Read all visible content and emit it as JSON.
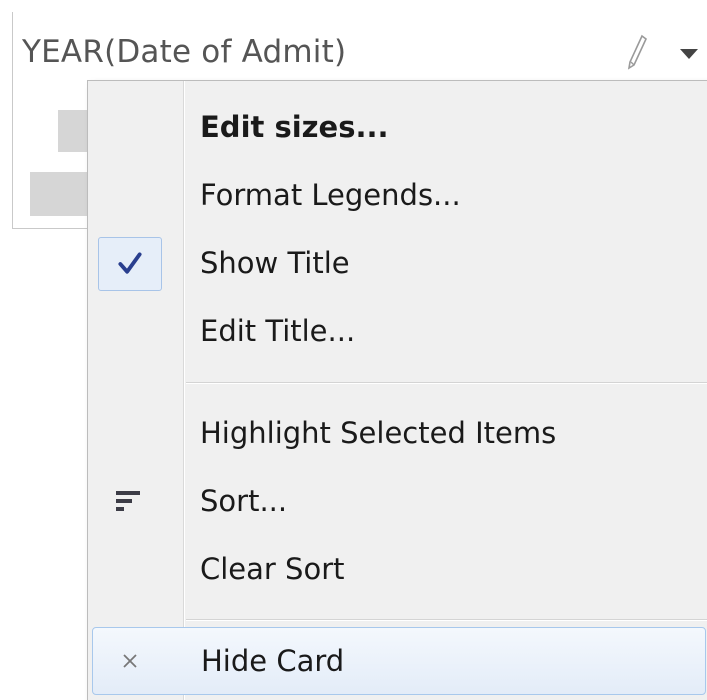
{
  "card": {
    "title": "YEAR(Date of Admit)"
  },
  "menu": {
    "items": [
      {
        "label": "Edit sizes...",
        "icon": "",
        "checked": false
      },
      {
        "label": "Format Legends...",
        "icon": "",
        "checked": false
      },
      {
        "label": "Show Title",
        "icon": "checkmark-icon",
        "checked": true
      },
      {
        "label": "Edit Title...",
        "icon": "",
        "checked": false
      },
      {
        "label": "Highlight Selected Items",
        "icon": "",
        "checked": false
      },
      {
        "label": "Sort...",
        "icon": "sort-icon",
        "checked": false
      },
      {
        "label": "Clear Sort",
        "icon": "",
        "checked": false
      },
      {
        "label": "Hide Card",
        "icon": "close-icon",
        "checked": false
      }
    ]
  },
  "colors": {
    "menu_background": "#f0f0f0",
    "check_color": "#2a3f8f",
    "hover_border": "#a8c8ec"
  }
}
